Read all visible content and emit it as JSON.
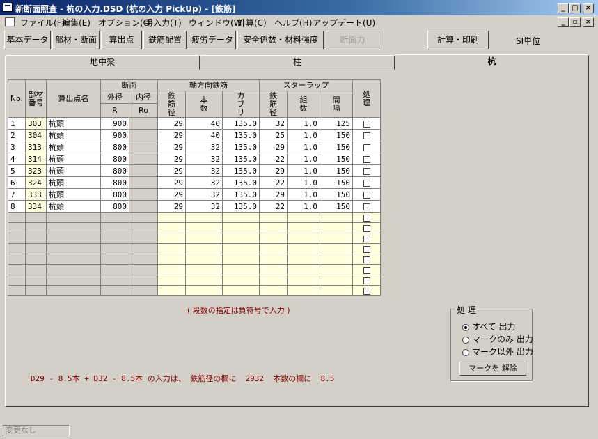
{
  "window": {
    "title": "新断面照査 - 杭の入力.DSD (杭の入力 PickUp) - [鉄筋]",
    "minimize": "_",
    "maximize": "□",
    "close": "×",
    "restore": "▫"
  },
  "menu": [
    "ファイル(F)",
    "編集(E)",
    "オプション(O)",
    "手入力(T)",
    "ウィンドウ(W)",
    "計算(C)",
    "ヘルプ(H)",
    "アップデート(U)"
  ],
  "toolbar": {
    "kihon": "基本データ",
    "buzai": "部材・断面",
    "santen": "算出点",
    "haikin": "鉄筋配置",
    "hirou": "疲労データ",
    "anzen": "安全係数・材料強度",
    "danmenryoku": "断面力",
    "keisan": "計算・印刷",
    "si": "SI単位"
  },
  "tabs": [
    "地中梁",
    "柱",
    "杭"
  ],
  "grid": {
    "h_no": "No.",
    "h_buzai": "部材番号",
    "h_santen": "算出点名",
    "h_danmen": "断面",
    "h_gaikei": "外径",
    "h_naikei": "内径",
    "h_R": "R",
    "h_Ro": "Ro",
    "h_jiku": "軸方向鉄筋",
    "h_tekkin": "鉄筋径",
    "h_honsu": "本数",
    "h_kaburi": "カブリ",
    "h_stirrup": "スターラップ",
    "h_s_tekkin": "鉄筋径",
    "h_kumi": "組数",
    "h_kankaku": "間隔",
    "h_shori": "処理",
    "rows": [
      [
        "1",
        "303",
        "杭頭",
        "900",
        "",
        "29",
        "40",
        "135.0",
        "32",
        "1.0",
        "125"
      ],
      [
        "2",
        "304",
        "杭頭",
        "900",
        "",
        "29",
        "40",
        "135.0",
        "25",
        "1.0",
        "150"
      ],
      [
        "3",
        "313",
        "杭頭",
        "800",
        "",
        "29",
        "32",
        "135.0",
        "29",
        "1.0",
        "150"
      ],
      [
        "4",
        "314",
        "杭頭",
        "800",
        "",
        "29",
        "32",
        "135.0",
        "22",
        "1.0",
        "150"
      ],
      [
        "5",
        "323",
        "杭頭",
        "800",
        "",
        "29",
        "32",
        "135.0",
        "29",
        "1.0",
        "150"
      ],
      [
        "6",
        "324",
        "杭頭",
        "800",
        "",
        "29",
        "32",
        "135.0",
        "22",
        "1.0",
        "150"
      ],
      [
        "7",
        "333",
        "杭頭",
        "800",
        "",
        "29",
        "32",
        "135.0",
        "29",
        "1.0",
        "150"
      ],
      [
        "8",
        "334",
        "杭頭",
        "800",
        "",
        "29",
        "32",
        "135.0",
        "22",
        "1.0",
        "150"
      ]
    ]
  },
  "note1": "( 段数の指定は負符号で入力 )",
  "note2": "D29 - 8.5本 + D32 - 8.5本 の入力は、 鉄筋径の欄に  2932  本数の欄に  8.5",
  "process": {
    "legend": "処 理",
    "all": "すべて  出力",
    "mark_only": "マークのみ 出力",
    "mark_except": "マーク以外 出力",
    "clear": "マークを 解除"
  },
  "status": "変更なし"
}
